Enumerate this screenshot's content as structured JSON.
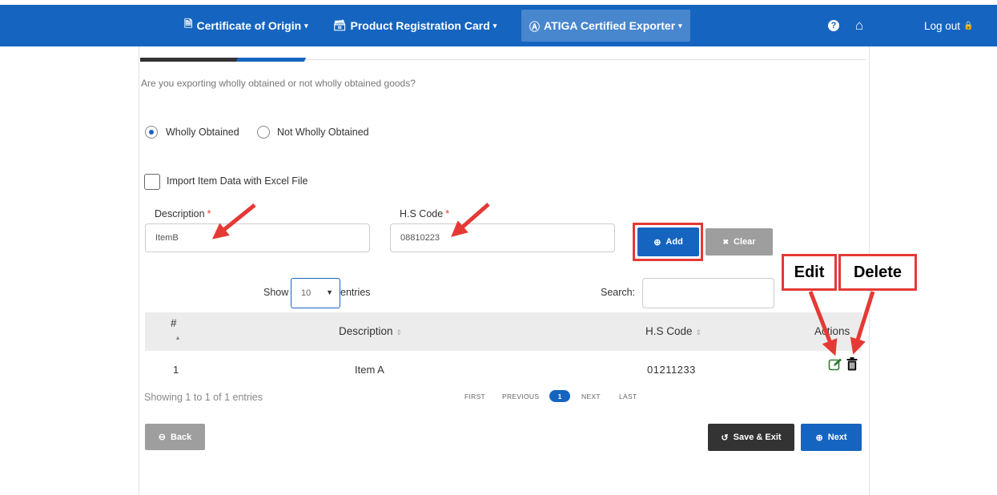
{
  "navbar": {
    "items": [
      {
        "icon": "🗎",
        "label": "Certificate of Origin",
        "caret": "▾"
      },
      {
        "icon": "🗃",
        "label": "Product Registration Card",
        "caret": "▾"
      },
      {
        "icon": "Ⓐ",
        "label": "ATIGA Certified Exporter",
        "caret": "▾"
      }
    ],
    "help_icon": "?",
    "home_icon": "⌂",
    "logout_label": "Log out",
    "lock_icon": "🔒"
  },
  "form": {
    "question": "Are you exporting wholly obtained or not wholly obtained goods?",
    "option_wholly": "Wholly Obtained",
    "option_not_wholly": "Not Wholly Obtained",
    "import_checkbox_label": "Import Item Data with Excel File",
    "description_label": "Description",
    "description_value": "ItemB",
    "hs_code_label": "H.S Code",
    "hs_code_value": "08810223",
    "required_mark": "*",
    "add_button": "Add",
    "add_icon": "⊕",
    "clear_button": "Clear",
    "clear_icon": "✖"
  },
  "annotations": {
    "edit_label": "Edit",
    "delete_label": "Delete"
  },
  "table": {
    "show_label": "Show",
    "entries_label": "entries",
    "page_size": "10",
    "search_label": "Search:",
    "search_value": "",
    "columns": [
      "#",
      "Description",
      "H.S Code",
      "Actions"
    ],
    "sort_icon": "⇕",
    "sort_asc_icon": "▴",
    "rows": [
      {
        "num": "1",
        "description": "Item A",
        "hs_code": "01211233"
      }
    ],
    "edit_icon": "✎",
    "delete_icon": "🗑",
    "info": "Showing 1 to 1 of 1 entries",
    "pager": {
      "first": "FIRST",
      "previous": "PREVIOUS",
      "current": "1",
      "next": "NEXT",
      "last": "LAST"
    }
  },
  "footer_buttons": {
    "back": "Back",
    "back_icon": "⊖",
    "save_exit": "Save & Exit",
    "save_icon": "↺",
    "next": "Next",
    "next_icon": "⊕"
  },
  "colors": {
    "brand": "#1565c0",
    "annotation_red": "#e53935",
    "save_dark": "#333333",
    "back_gray": "#9e9e9e",
    "clear_gray": "#9e9e9e",
    "edit_green": "#2e7d32"
  }
}
